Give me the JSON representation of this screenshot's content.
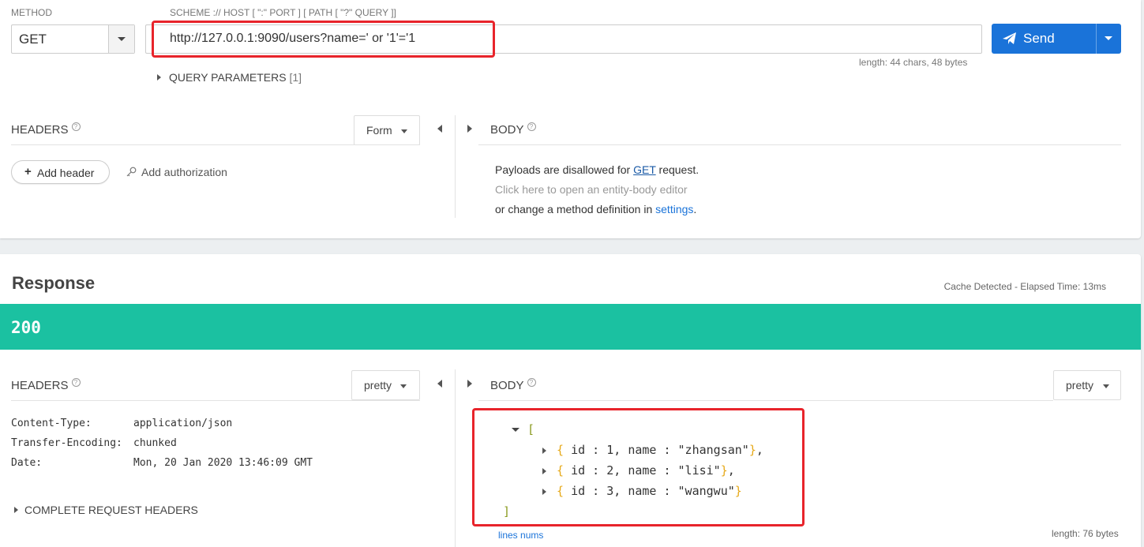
{
  "request": {
    "method_label": "METHOD",
    "method_value": "GET",
    "url_label": "SCHEME :// HOST [ \":\" PORT ] [ PATH [ \"?\" QUERY ]]",
    "url_value": "http://127.0.0.1:9090/users?name=' or '1'='1",
    "send_label": "Send",
    "length_text": "length: 44 chars, 48 bytes",
    "query_params_label": "QUERY PARAMETERS",
    "query_params_count": "[1]",
    "headers_title": "HEADERS",
    "headers_mode": "Form",
    "add_header_label": "Add header",
    "add_auth_label": "Add authorization",
    "body_title": "BODY",
    "body_msg1_pre": "Payloads are disallowed for ",
    "body_msg1_link": "GET",
    "body_msg1_post": " request.",
    "body_msg2": "Click here to open an entity-body editor",
    "body_msg3_pre": "or change a method definition in ",
    "body_msg3_link": "settings",
    "body_msg3_post": "."
  },
  "response": {
    "title": "Response",
    "elapsed": "Cache Detected - Elapsed Time: 13ms",
    "status_code": "200",
    "status_color": "#1bc1a1",
    "headers_title": "HEADERS",
    "headers_mode": "pretty",
    "body_title": "BODY",
    "body_mode": "pretty",
    "headers": [
      {
        "key": "Content-Type:",
        "value": "application/json"
      },
      {
        "key": "Transfer-Encoding:",
        "value": "chunked"
      },
      {
        "key": "Date:",
        "value": "Mon, 20 Jan 2020 13:46:09 GMT"
      }
    ],
    "complete_headers_label": "COMPLETE REQUEST HEADERS",
    "json": {
      "open": "[",
      "close": "]",
      "items": [
        {
          "id_key": "id",
          "id_val": "1",
          "name_key": "name",
          "name_val": "\"zhangsan\"",
          "trail": ","
        },
        {
          "id_key": "id",
          "id_val": "2",
          "name_key": "name",
          "name_val": "\"lisi\"",
          "trail": ","
        },
        {
          "id_key": "id",
          "id_val": "3",
          "name_key": "name",
          "name_val": "\"wangwu\"",
          "trail": ""
        }
      ]
    },
    "lines_nums_label": "lines nums",
    "length_text": "length: 76 bytes"
  },
  "colors": {
    "accent": "#1a73d9",
    "highlight": "#e8242b"
  }
}
